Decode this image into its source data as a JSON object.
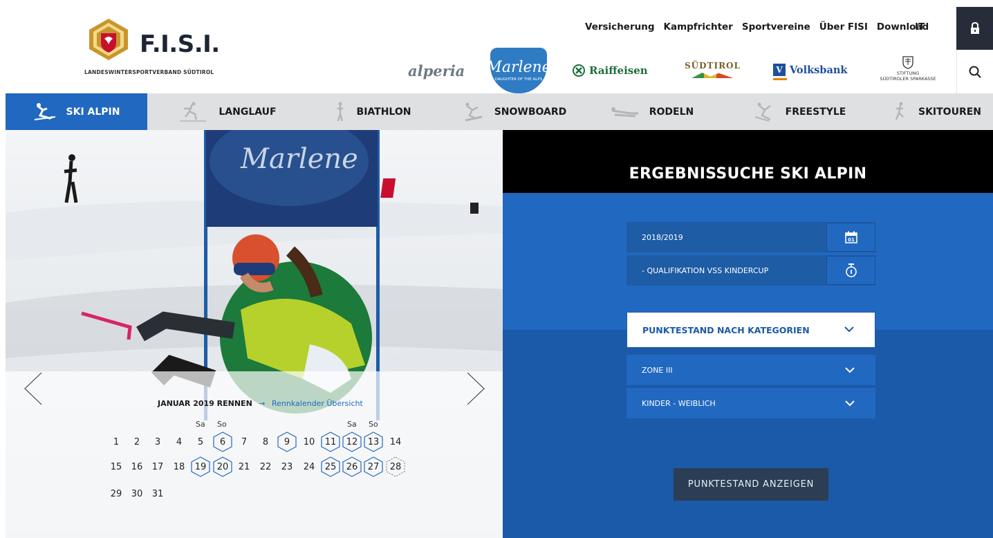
{
  "brand": {
    "title": "F.I.S.I.",
    "subtitle": "LANDESWINTERSPORTVERBAND SÜDTIROL"
  },
  "topnav": [
    "Versicherung",
    "Kampfrichter",
    "Sportvereine",
    "Über FISI",
    "Download"
  ],
  "language": "IT",
  "sponsors": {
    "alperia": "alperia",
    "marlene": "Marlene",
    "marlene_sub": "DAUGHTER OF THE ALPS",
    "raiffeisen": "Raiffeisen",
    "suedtirol": "SÜDTIROL",
    "volksbank": "Volksbank",
    "sparkasse_1": "STIFTUNG",
    "sparkasse_2": "SÜDTIROLER SPARKASSE"
  },
  "sports": [
    "SKI ALPIN",
    "LANGLAUF",
    "BIATHLON",
    "SNOWBOARD",
    "RODELN",
    "FREESTYLE",
    "SKITOUREN"
  ],
  "calendar": {
    "month_label": "JANUAR 2019 RENNEN",
    "arrow": "→",
    "overview_link": "Rennkalender Übersicht",
    "weekday_sat": "Sa",
    "weekday_sun": "So",
    "days": [
      "1",
      "2",
      "3",
      "4",
      "5",
      "6",
      "7",
      "8",
      "9",
      "10",
      "11",
      "12",
      "13",
      "14",
      "15",
      "16",
      "17",
      "18",
      "19",
      "20",
      "21",
      "22",
      "23",
      "24",
      "25",
      "26",
      "27",
      "28",
      "29",
      "30",
      "31"
    ],
    "race_days": [
      6,
      9,
      11,
      12,
      13,
      19,
      20,
      25,
      26,
      27
    ],
    "upcoming_days": [
      28
    ]
  },
  "panel": {
    "title": "ERGEBNISSUCHE SKI ALPIN",
    "season": "2018/2019",
    "race": "- QUALIFIKATION VSS KINDERCUP",
    "ranking": "PUNKTESTAND NACH KATEGORIEN",
    "zone": "ZONE III",
    "category": "KINDER - WEIBLICH",
    "button": "PUNKTESTAND ANZEIGEN",
    "calendar_icon_day": "01"
  },
  "colors": {
    "accent": "#2168c0",
    "dark": "#262d39",
    "button": "#2c3e55"
  }
}
